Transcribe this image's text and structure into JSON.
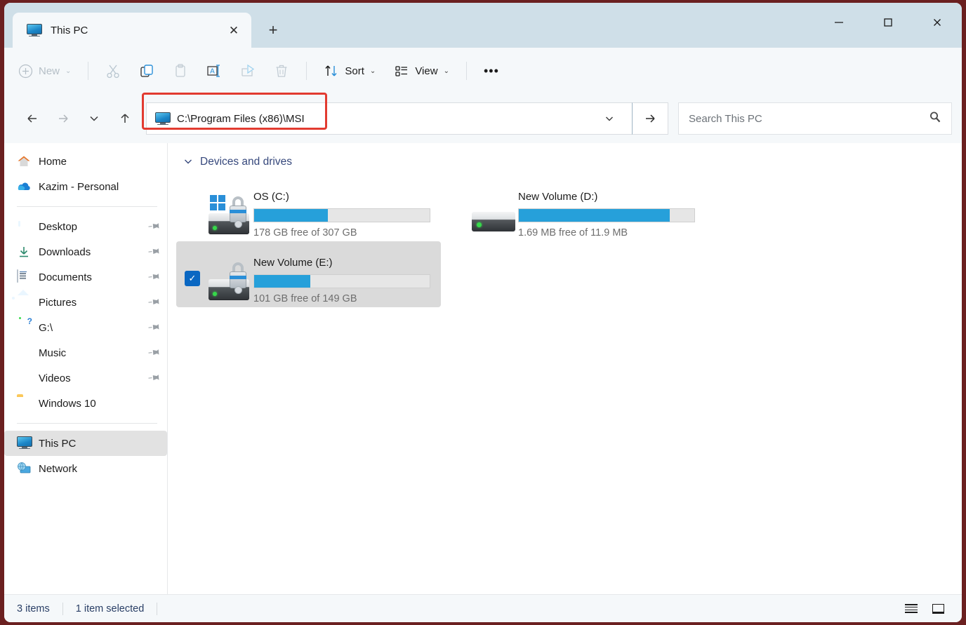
{
  "window": {
    "tab_title": "This PC",
    "tab_icon": "monitor-icon",
    "close_glyph": "✕",
    "newtab_glyph": "+",
    "minimize_glyph": "—",
    "maximize_glyph": "□",
    "wclose_glyph": "✕"
  },
  "toolbar": {
    "new_label": "New",
    "new_glyph": "+",
    "chevron": "⌄",
    "cut_icon": "scissors-icon",
    "copy_icon": "copy-icon",
    "paste_icon": "clipboard-icon",
    "rename_icon": "rename-icon",
    "share_icon": "share-icon",
    "delete_icon": "trash-icon",
    "sort_label": "Sort",
    "sort_glyph": "⇅",
    "view_label": "View",
    "view_icon": "list-icon",
    "more_label": "•••"
  },
  "address": {
    "back_glyph": "←",
    "forward_glyph": "→",
    "recent_glyph": "⌄",
    "up_glyph": "↑",
    "path": "C:\\Program Files (x86)\\MSI",
    "path_icon": "monitor-icon",
    "dropdown_glyph": "⌄",
    "go_glyph": "→",
    "highlight_color": "#e23b30"
  },
  "search": {
    "placeholder": "Search This PC",
    "icon": "search-icon",
    "glyph": "⚲"
  },
  "sidebar": {
    "items": [
      {
        "label": "Home",
        "icon": "home-icon",
        "pinned": false,
        "selected": false
      },
      {
        "label": "Kazim - Personal",
        "icon": "onedrive-cloud-icon",
        "pinned": false,
        "selected": false
      },
      {
        "label": "Desktop",
        "icon": "desktop-icon",
        "pinned": true,
        "selected": false
      },
      {
        "label": "Downloads",
        "icon": "download-arrow-icon",
        "pinned": true,
        "selected": false
      },
      {
        "label": "Documents",
        "icon": "documents-icon",
        "pinned": true,
        "selected": false
      },
      {
        "label": "Pictures",
        "icon": "pictures-icon",
        "pinned": true,
        "selected": false
      },
      {
        "label": "G:\\",
        "icon": "disconnected-drive-icon",
        "pinned": true,
        "selected": false
      },
      {
        "label": "Music",
        "icon": "music-icon",
        "pinned": true,
        "selected": false
      },
      {
        "label": "Videos",
        "icon": "videos-icon",
        "pinned": true,
        "selected": false
      },
      {
        "label": "Windows 10",
        "icon": "folder-icon",
        "pinned": false,
        "selected": false
      },
      {
        "label": "This PC",
        "icon": "monitor-icon",
        "pinned": false,
        "selected": true
      },
      {
        "label": "Network",
        "icon": "network-icon",
        "pinned": false,
        "selected": false
      }
    ],
    "pin_glyph": "📌"
  },
  "main": {
    "group_title": "Devices and drives",
    "group_chevron": "⌄",
    "drives": [
      {
        "name": "OS (C:)",
        "capacity_text": "178 GB free of 307 GB",
        "used_percent": 42,
        "icon": "windows-drive-bitlocker-unlocked-icon",
        "selected": false
      },
      {
        "name": "New Volume (D:)",
        "capacity_text": "1.69 MB free of 11.9 MB",
        "used_percent": 86,
        "icon": "drive-icon",
        "selected": false
      },
      {
        "name": "New Volume (E:)",
        "capacity_text": "101 GB free of 149 GB",
        "used_percent": 32,
        "icon": "drive-bitlocker-unlocked-icon",
        "selected": true
      }
    ],
    "check_glyph": "✓"
  },
  "status": {
    "item_count": "3 items",
    "selection": "1 item selected",
    "details_view_icon": "details-view-icon",
    "large_icons_view_icon": "large-icons-view-icon"
  }
}
